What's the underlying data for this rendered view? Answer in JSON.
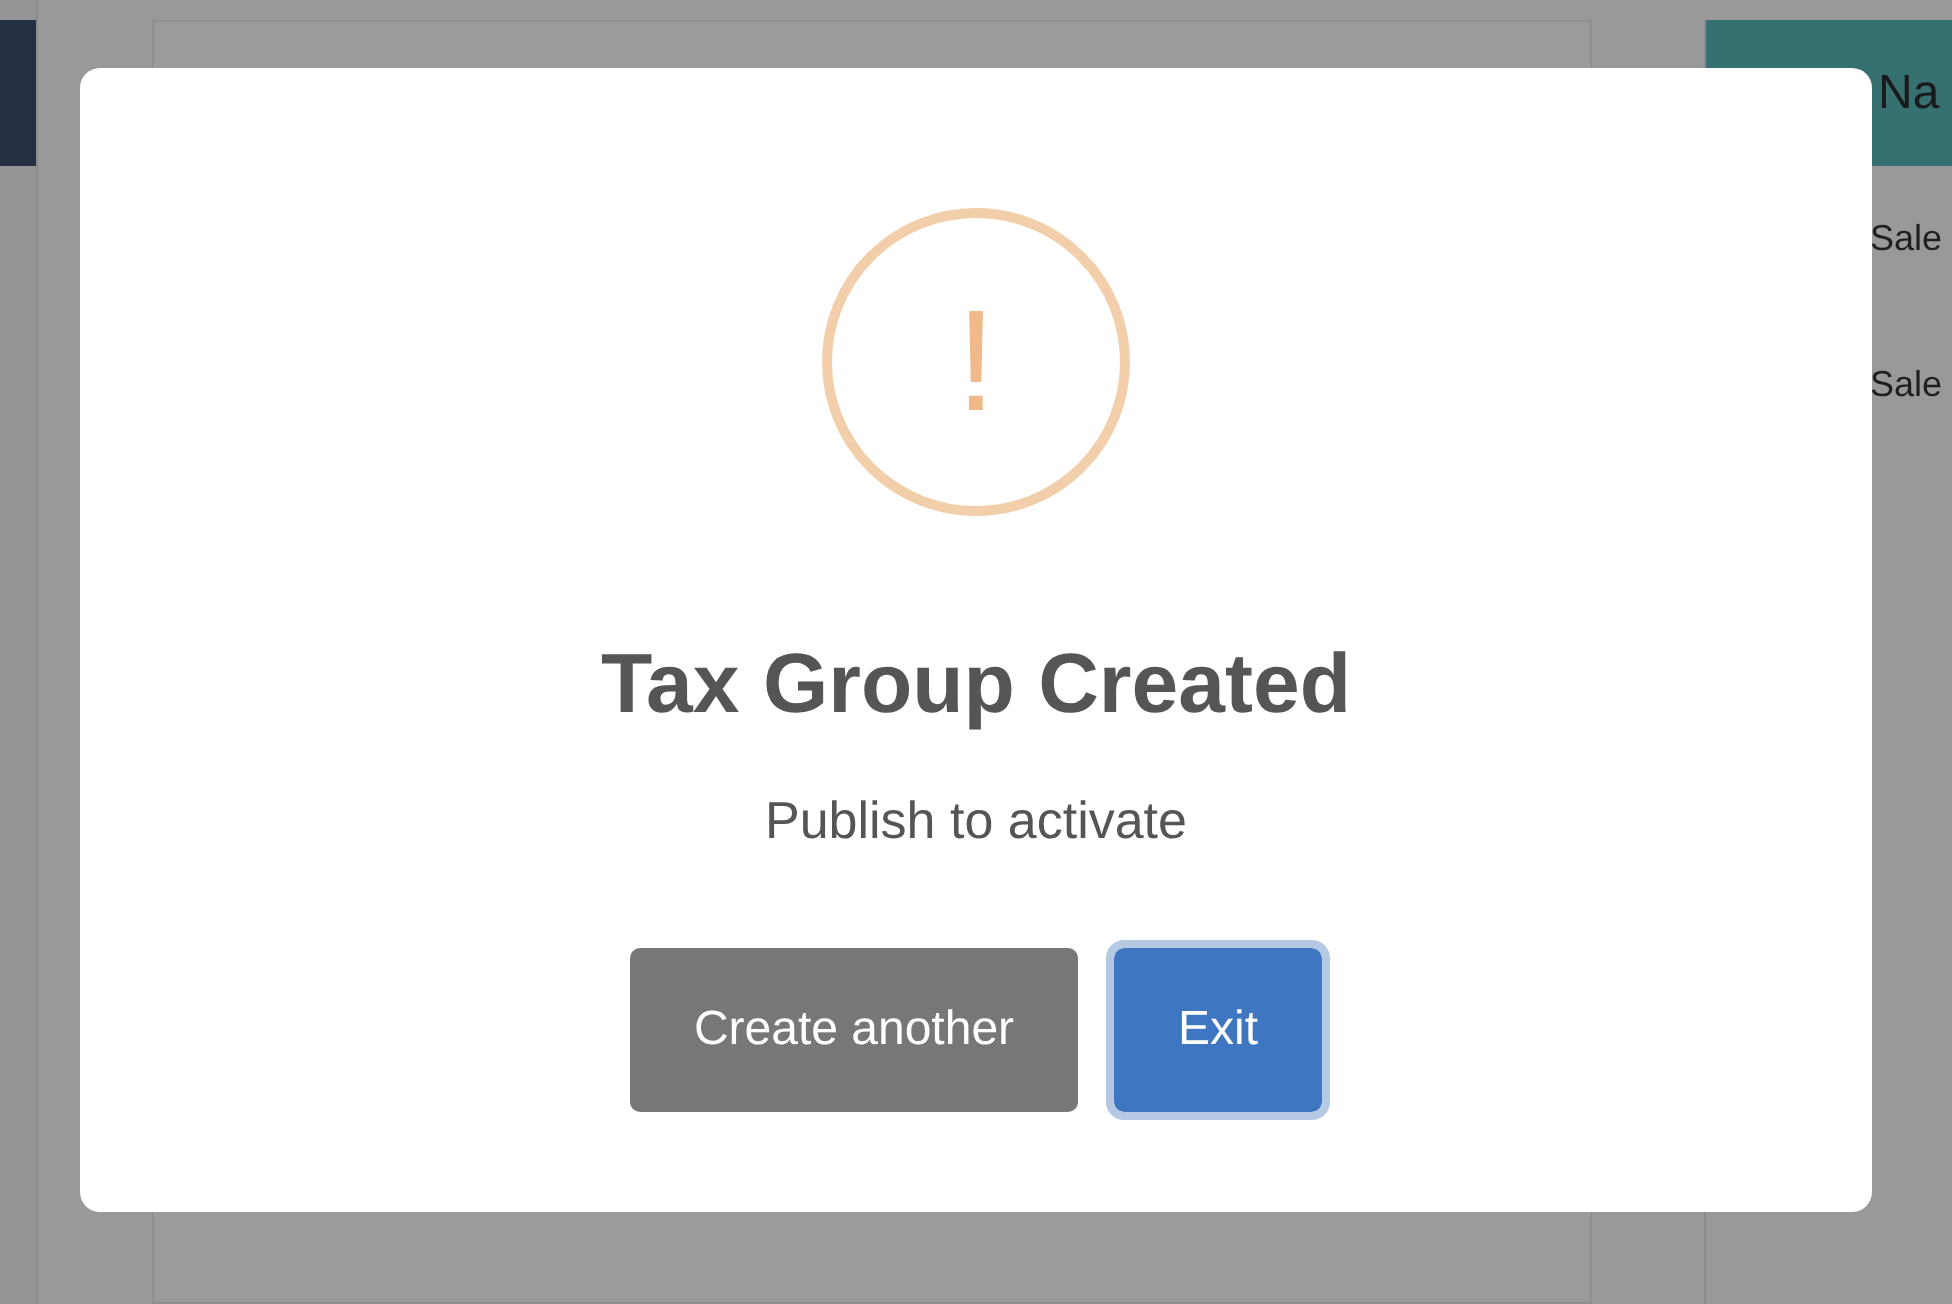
{
  "background": {
    "table": {
      "column_header": "Na",
      "rows": [
        "Sale",
        "Sale"
      ]
    }
  },
  "dialog": {
    "icon": "!",
    "title": "Tax Group Created",
    "message": "Publish to activate",
    "buttons": [
      {
        "label": "Create another",
        "kind": "secondary",
        "focused": false
      },
      {
        "label": "Exit",
        "kind": "primary",
        "focused": true
      }
    ]
  }
}
